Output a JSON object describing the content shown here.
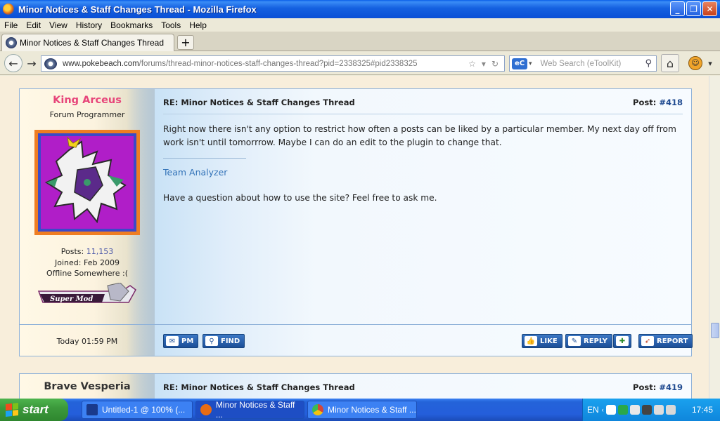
{
  "window": {
    "title": "Minor Notices & Staff Changes Thread - Mozilla Firefox",
    "buttons": [
      "minimize",
      "maximize",
      "close"
    ]
  },
  "menu": [
    "File",
    "Edit",
    "View",
    "History",
    "Bookmarks",
    "Tools",
    "Help"
  ],
  "tabs": [
    {
      "label": "Minor Notices & Staff Changes Thread"
    }
  ],
  "newtab_label": "+",
  "address": {
    "url_domain": "www.pokebeach.com",
    "url_path": "/forums/thread-minor-notices-staff-changes-thread?pid=2338325#pid2338325"
  },
  "search": {
    "engine": "eC",
    "placeholder": "Web Search (eToolKit)"
  },
  "posts": [
    {
      "username": "King Arceus",
      "user_title": "Forum Programmer",
      "posts_label": "Posts:",
      "posts_value": "11,153",
      "joined": "Joined: Feb 2009",
      "status": "Offline Somewhere :(",
      "badge": "Super Mod",
      "time": "Today 01:59 PM",
      "subject": "RE: Minor Notices & Staff Changes Thread",
      "post_label": "Post:",
      "post_number": "#418",
      "body": "Right now there isn't any option to restrict how often a posts can be liked by a particular member. My next day off from work isn't until tomorrrow. Maybe I can do an edit to the plugin to change that.",
      "signature_link": "Team Analyzer",
      "signature_text": "Have a question about how to use the site? Feel free to ask me.",
      "buttons": {
        "pm": "PM",
        "find": "FIND",
        "like": "LIKE",
        "reply": "REPLY",
        "report": "REPORT"
      }
    },
    {
      "username": "Brave Vesperia",
      "subject": "RE: Minor Notices & Staff Changes Thread",
      "post_label": "Post:",
      "post_number": "#419"
    }
  ],
  "taskbar": {
    "start_label": "start",
    "tasks": [
      {
        "label": "Untitled-1 @ 100% (...",
        "icon_color": "#1a3a8c"
      },
      {
        "label": "Minor Notices & Staff ...",
        "icon_color": "#e86c14"
      },
      {
        "label": "Minor Notices & Staff ...",
        "icon_color": "#d44638"
      }
    ],
    "language": "EN",
    "clock": "17:45"
  },
  "colors": {
    "username": "#e7457a",
    "link": "#3373b8",
    "accent_blue": "#1c4f98"
  }
}
